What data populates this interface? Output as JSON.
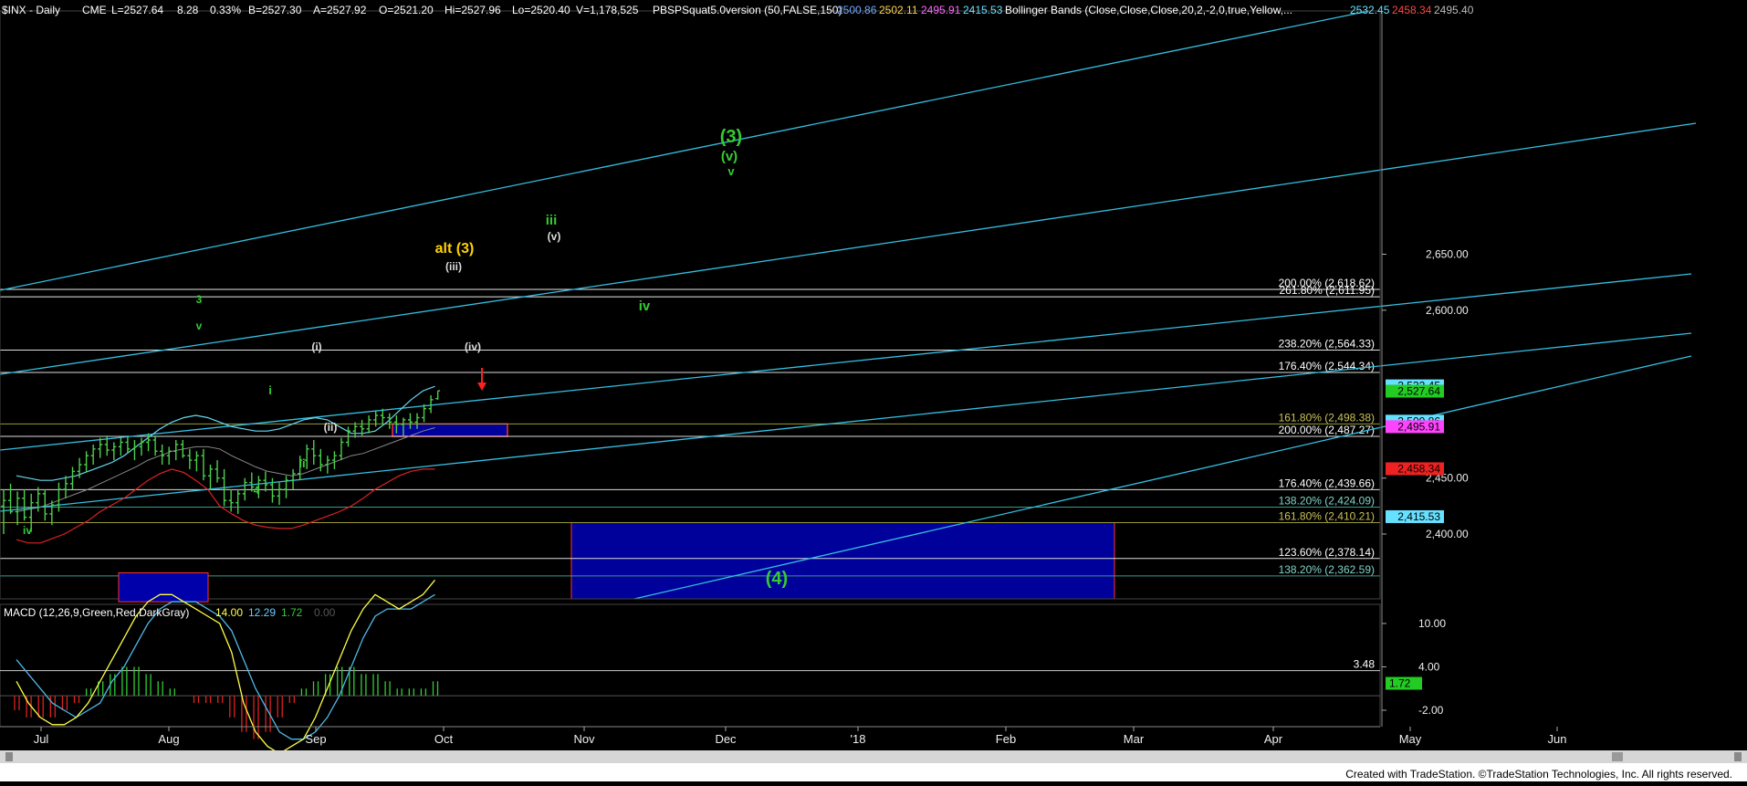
{
  "header": {
    "symbol": "$INX - Daily",
    "exchange": "CME",
    "last": "L=2527.64",
    "change": "8.28",
    "change_pct": "0.33%",
    "bid": "B=2527.30",
    "ask": "A=2527.92",
    "open": "O=2521.20",
    "high": "Hi=2527.96",
    "low": "Lo=2520.40",
    "volume": "V=1,178,525",
    "indicator": "PBSPSquat5.0version (50,FALSE,150)",
    "ind_vals": [
      {
        "v": "2500.86",
        "color": "#6fa8ff"
      },
      {
        "v": "2502.11",
        "color": "#ffd24a"
      },
      {
        "v": "2495.91",
        "color": "#ff66ff"
      },
      {
        "v": "2415.53",
        "color": "#66e0ff"
      }
    ],
    "bollinger": "Bollinger Bands (Close,Close,Close,20,2,-2,0,true,Yellow,...",
    "bb_vals": [
      {
        "v": "2532.45",
        "color": "#66e0ff"
      },
      {
        "v": "2458.34",
        "color": "#ff4444"
      },
      {
        "v": "2495.40",
        "color": "#bbbbbb"
      }
    ]
  },
  "chart_data": [
    {
      "type": "bar",
      "title": "$INX - Daily",
      "ylim": [
        2330,
        2710
      ],
      "y_ticks": [
        2400,
        2450,
        2600,
        2650
      ],
      "x_ticks": [
        "Jul",
        "Aug",
        "Sep",
        "Oct",
        "Nov",
        "Dec",
        "'18",
        "Feb",
        "Mar",
        "Apr",
        "May",
        "Jun"
      ],
      "x_tick_pos": [
        45,
        185,
        346,
        486,
        640,
        795,
        940,
        1102,
        1242,
        1395,
        1545,
        1706
      ],
      "grid": false,
      "ohlc": [
        [
          2425,
          2440,
          2400,
          2430
        ],
        [
          2430,
          2445,
          2418,
          2420
        ],
        [
          2420,
          2438,
          2408,
          2432
        ],
        [
          2432,
          2440,
          2412,
          2415
        ],
        [
          2415,
          2436,
          2402,
          2428
        ],
        [
          2428,
          2442,
          2420,
          2436
        ],
        [
          2436,
          2440,
          2412,
          2418
        ],
        [
          2418,
          2430,
          2408,
          2426
        ],
        [
          2426,
          2446,
          2420,
          2440
        ],
        [
          2440,
          2452,
          2432,
          2445
        ],
        [
          2445,
          2460,
          2440,
          2456
        ],
        [
          2456,
          2468,
          2450,
          2462
        ],
        [
          2462,
          2474,
          2455,
          2470
        ],
        [
          2470,
          2480,
          2462,
          2476
        ],
        [
          2476,
          2486,
          2468,
          2480
        ],
        [
          2480,
          2488,
          2470,
          2475
        ],
        [
          2475,
          2482,
          2466,
          2478
        ],
        [
          2478,
          2486,
          2470,
          2482
        ],
        [
          2482,
          2488,
          2472,
          2476
        ],
        [
          2476,
          2484,
          2466,
          2478
        ],
        [
          2478,
          2486,
          2470,
          2482
        ],
        [
          2482,
          2490,
          2474,
          2484
        ],
        [
          2484,
          2488,
          2470,
          2474
        ],
        [
          2474,
          2480,
          2462,
          2470
        ],
        [
          2470,
          2478,
          2462,
          2474
        ],
        [
          2474,
          2484,
          2466,
          2480
        ],
        [
          2480,
          2484,
          2468,
          2470
        ],
        [
          2470,
          2476,
          2458,
          2466
        ],
        [
          2466,
          2474,
          2456,
          2470
        ],
        [
          2470,
          2476,
          2448,
          2452
        ],
        [
          2452,
          2462,
          2440,
          2458
        ],
        [
          2458,
          2466,
          2446,
          2450
        ],
        [
          2450,
          2458,
          2425,
          2430
        ],
        [
          2430,
          2440,
          2420,
          2428
        ],
        [
          2428,
          2440,
          2418,
          2436
        ],
        [
          2436,
          2450,
          2430,
          2446
        ],
        [
          2446,
          2455,
          2438,
          2442
        ],
        [
          2442,
          2452,
          2432,
          2448
        ],
        [
          2448,
          2456,
          2438,
          2444
        ],
        [
          2444,
          2450,
          2428,
          2434
        ],
        [
          2434,
          2446,
          2426,
          2440
        ],
        [
          2440,
          2452,
          2432,
          2448
        ],
        [
          2448,
          2458,
          2440,
          2454
        ],
        [
          2454,
          2470,
          2448,
          2466
        ],
        [
          2466,
          2480,
          2458,
          2476
        ],
        [
          2476,
          2484,
          2462,
          2470
        ],
        [
          2470,
          2476,
          2456,
          2462
        ],
        [
          2462,
          2470,
          2454,
          2466
        ],
        [
          2466,
          2474,
          2458,
          2470
        ],
        [
          2470,
          2486,
          2466,
          2482
        ],
        [
          2482,
          2496,
          2478,
          2492
        ],
        [
          2492,
          2500,
          2486,
          2496
        ],
        [
          2496,
          2502,
          2488,
          2494
        ],
        [
          2494,
          2506,
          2490,
          2502
        ],
        [
          2502,
          2510,
          2496,
          2506
        ],
        [
          2506,
          2512,
          2498,
          2504
        ],
        [
          2504,
          2508,
          2494,
          2500
        ],
        [
          2500,
          2506,
          2490,
          2498
        ],
        [
          2498,
          2504,
          2488,
          2502
        ],
        [
          2502,
          2508,
          2494,
          2500
        ],
        [
          2500,
          2508,
          2494,
          2504
        ],
        [
          2504,
          2516,
          2500,
          2512
        ],
        [
          2512,
          2524,
          2508,
          2520
        ],
        [
          2521,
          2528,
          2520,
          2528
        ]
      ],
      "bb_upper": [
        2452,
        2450,
        2448,
        2448,
        2450,
        2452,
        2456,
        2460,
        2464,
        2470,
        2478,
        2486,
        2494,
        2500,
        2504,
        2506,
        2504,
        2500,
        2496,
        2494,
        2492,
        2492,
        2494,
        2498,
        2502,
        2504,
        2502,
        2496,
        2490,
        2490,
        2492,
        2500,
        2510,
        2520,
        2528,
        2532
      ],
      "bb_mid": [
        2420,
        2422,
        2424,
        2428,
        2432,
        2436,
        2440,
        2445,
        2450,
        2455,
        2460,
        2466,
        2470,
        2474,
        2476,
        2478,
        2478,
        2476,
        2470,
        2465,
        2460,
        2456,
        2454,
        2452,
        2454,
        2458,
        2462,
        2466,
        2470,
        2472,
        2476,
        2480,
        2484,
        2488,
        2492,
        2495
      ],
      "bb_lower": [
        2395,
        2392,
        2392,
        2396,
        2400,
        2406,
        2412,
        2420,
        2426,
        2432,
        2440,
        2448,
        2454,
        2458,
        2455,
        2448,
        2440,
        2425,
        2418,
        2412,
        2408,
        2406,
        2405,
        2405,
        2408,
        2412,
        2416,
        2420,
        2425,
        2432,
        2440,
        2446,
        2452,
        2456,
        2458,
        2458
      ],
      "fib_levels": [
        {
          "label": "200.00% (2,618.62)",
          "y": 2618.62,
          "color": "#e8e8e8",
          "tc": "#ffffff"
        },
        {
          "label": "261.80% (2,611.95)",
          "y": 2611.95,
          "color": "#e8e8e8",
          "tc": "#ffffff"
        },
        {
          "label": "238.20% (2,564.33)",
          "y": 2564.33,
          "color": "#dddddd",
          "tc": "#ffffff"
        },
        {
          "label": "176.40% (2,544.34)",
          "y": 2544.34,
          "color": "#dddddd",
          "tc": "#ffffff"
        },
        {
          "label": "161.80% (2,498.38)",
          "y": 2498.38,
          "color": "#9a9a3a",
          "tc": "#c9c15a"
        },
        {
          "label": "200.00% (2,487.27)",
          "y": 2487.27,
          "color": "#dddddd",
          "tc": "#ffffff"
        },
        {
          "label": "176.40% (2,439.66)",
          "y": 2439.66,
          "color": "#dddddd",
          "tc": "#ffffff"
        },
        {
          "label": "138.20% (2,424.09)",
          "y": 2424.09,
          "color": "#3a9a8a",
          "tc": "#7fd4c6"
        },
        {
          "label": "161.80% (2,410.21)",
          "y": 2410.21,
          "color": "#9a9a3a",
          "tc": "#c9c15a"
        },
        {
          "label": "123.60% (2,378.14)",
          "y": 2378.14,
          "color": "#dddddd",
          "tc": "#ffffff"
        },
        {
          "label": "138.20% (2,362.59)",
          "y": 2362.59,
          "color": "#3a9a8a",
          "tc": "#7fd4c6"
        }
      ],
      "price_badges": [
        {
          "v": "2,532.45",
          "y": 2532.45,
          "bg": "#66e0ff",
          "fg": "#000000"
        },
        {
          "v": "2,527.64",
          "y": 2527.64,
          "bg": "#22cc22",
          "fg": "#000000"
        },
        {
          "v": "2,500.86",
          "y": 2500.86,
          "bg": "#66e0ff",
          "fg": "#000000"
        },
        {
          "v": "2,495.91",
          "y": 2495.91,
          "bg": "#ff44ff",
          "fg": "#000000"
        },
        {
          "v": "2,458.34",
          "y": 2458.34,
          "bg": "#ee2222",
          "fg": "#000000"
        },
        {
          "v": "2,415.53",
          "y": 2415.53,
          "bg": "#66e0ff",
          "fg": "#000000"
        }
      ],
      "wave_labels": [
        {
          "t": "3",
          "c": "#33cc33"
        },
        {
          "t": "v",
          "c": "#33cc33"
        },
        {
          "t": "iv",
          "c": "#33cc33"
        },
        {
          "t": "4",
          "c": "#33cc33"
        },
        {
          "t": "i",
          "c": "#33cc33"
        },
        {
          "t": "ii",
          "c": "#33cc33"
        },
        {
          "t": "(i)",
          "c": "#dddddd"
        },
        {
          "t": "(ii)",
          "c": "#dddddd"
        },
        {
          "t": "(iii)",
          "c": "#dddddd"
        },
        {
          "t": "(iv)",
          "c": "#dddddd"
        },
        {
          "t": "(v)",
          "c": "#dddddd"
        },
        {
          "t": "alt (3)",
          "c": "#ffd200"
        },
        {
          "t": "iii",
          "c": "#33cc33"
        },
        {
          "t": "iv",
          "c": "#33cc33"
        },
        {
          "t": "(3)",
          "c": "#33cc33"
        },
        {
          "t": "(v)",
          "c": "#33cc33"
        },
        {
          "t": "v",
          "c": "#33cc33"
        },
        {
          "t": "(4)",
          "c": "#33cc33"
        }
      ]
    },
    {
      "type": "bar",
      "title": "MACD (12,26,9,Green,Red,DarkGray)",
      "legend": [
        {
          "v": "14.00",
          "color": "#ffff44"
        },
        {
          "v": "12.29",
          "color": "#66ccff"
        },
        {
          "v": "1.72",
          "color": "#33cc33"
        },
        {
          "v": "0.00",
          "color": "#555555"
        }
      ],
      "y_ticks": [
        10.0,
        4.0,
        -2.0
      ],
      "y_tick_labels": [
        "10.00",
        "4.00",
        "-2.00"
      ],
      "level_label": "3.48",
      "badge": "1.72",
      "ylim": [
        -8,
        20
      ],
      "macd": [
        2,
        -1,
        -3,
        -4,
        -4,
        -3,
        -1,
        2,
        5,
        8,
        11,
        13,
        14,
        14,
        13,
        12,
        11,
        10,
        6,
        -1,
        -5,
        -7,
        -8,
        -7,
        -6,
        -3,
        1,
        5,
        9,
        12,
        14,
        13,
        12,
        13,
        14,
        16
      ],
      "signal": [
        5,
        3,
        1,
        -1,
        -2,
        -3,
        -2,
        -1,
        2,
        4,
        7,
        10,
        12,
        13,
        13,
        13,
        12,
        11,
        9,
        5,
        1,
        -2,
        -5,
        -6,
        -6,
        -5,
        -3,
        0,
        4,
        8,
        11,
        12,
        12,
        12,
        13,
        14
      ],
      "hist": [
        -2,
        -3,
        -3,
        -3,
        -2,
        -1,
        1,
        2,
        3,
        4,
        4,
        3,
        2,
        1,
        0,
        -1,
        -1,
        -1,
        -3,
        -5,
        -6,
        -5,
        -3,
        -1,
        1,
        2,
        3,
        4,
        4,
        3,
        3,
        2,
        1,
        1,
        1,
        2
      ]
    }
  ],
  "footer": {
    "credit": "Created with TradeStation. ©TradeStation Technologies, Inc. All rights reserved."
  }
}
